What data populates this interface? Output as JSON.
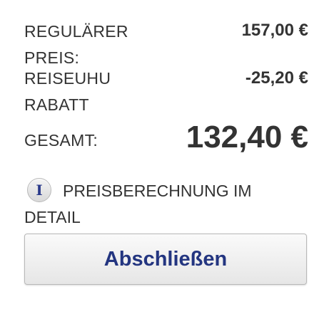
{
  "summary": {
    "regular_label": "REGULÄRER PREIS:",
    "regular_value": "157,00 €",
    "discount_label": "REISEUHU RABATT",
    "discount_value": "-25,20 €",
    "total_label": "GESAMT:",
    "total_value": "132,40 €"
  },
  "details": {
    "icon_glyph": "i",
    "icon_name": "info-icon",
    "label": "PREISBERECHNUNG IM DETAIL"
  },
  "actions": {
    "submit_label": "Abschließen"
  },
  "colors": {
    "text": "#333333",
    "button_text": "#233580",
    "icon_glyph": "#2a3a8a"
  }
}
